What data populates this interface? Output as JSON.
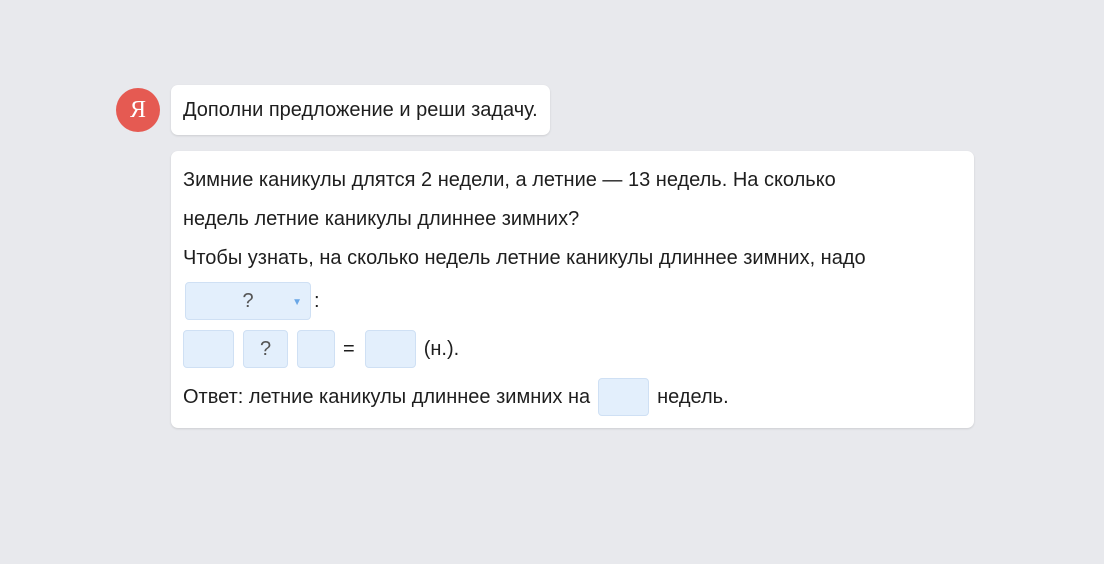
{
  "header": {
    "avatar_letter": "Я",
    "task_title": "Дополни предложение и реши задачу."
  },
  "problem": {
    "line1": "Зимние каникулы длятся 2 недели, а летние — 13 недель. На сколько",
    "line2": "недель летние каникулы длиннее зимних?",
    "line3": "Чтобы узнать, на сколько недель летние каникулы длиннее зимних, надо"
  },
  "action_select": {
    "value": "?",
    "suffix": ":"
  },
  "equation": {
    "operand1": "",
    "operator": "?",
    "operand2": "",
    "equals": "=",
    "result": "",
    "unit": "(н.)."
  },
  "answer": {
    "prefix": "Ответ: летние каникулы длиннее зимних на",
    "value": "",
    "suffix": "недель."
  },
  "colors": {
    "background": "#e8e9ed",
    "avatar": "#e55a52",
    "input_fill": "#e3effc",
    "dropdown_arrow": "#6aa7e6"
  }
}
